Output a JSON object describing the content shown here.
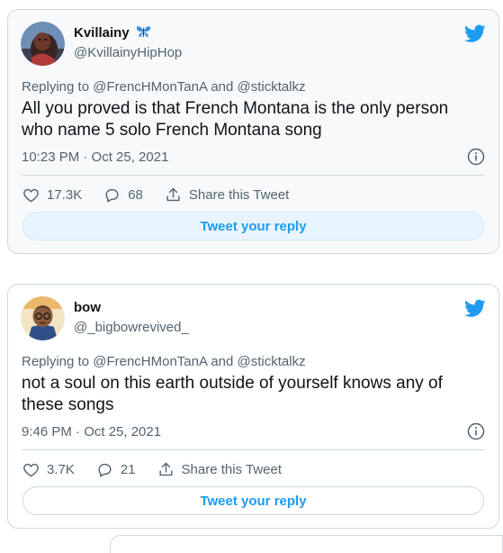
{
  "colors": {
    "accent": "#1d9bf0",
    "text": "#0f1419",
    "muted": "#536471",
    "border": "#cfd9de"
  },
  "tweets": [
    {
      "display_name": "Kvillainy",
      "name_emoji": "butterfly-icon",
      "handle": "@KvillainyHipHop",
      "reply_to": "Replying to @FrencHMonTanA and @sticktalkz",
      "text": "All you proved is that French Montana is the only person who name 5 solo French Montana song",
      "timestamp": "10:23 PM · Oct 25, 2021",
      "likes": "17.3K",
      "replies": "68",
      "share_label": "Share this Tweet",
      "reply_button": "Tweet your reply",
      "avatar_icon": "avatar-photo",
      "brand_icon": "twitter-bird-icon"
    },
    {
      "display_name": "bow",
      "name_emoji": "",
      "handle": "@_bigbowrevived_",
      "reply_to": "Replying to @FrencHMonTanA and @sticktalkz",
      "text": "not a soul on this earth outside of yourself knows any of these songs",
      "timestamp": "9:46 PM · Oct 25, 2021",
      "likes": "3.7K",
      "replies": "21",
      "share_label": "Share this Tweet",
      "reply_button": "Tweet your reply",
      "avatar_icon": "avatar-cartoon",
      "brand_icon": "twitter-bird-icon"
    }
  ]
}
